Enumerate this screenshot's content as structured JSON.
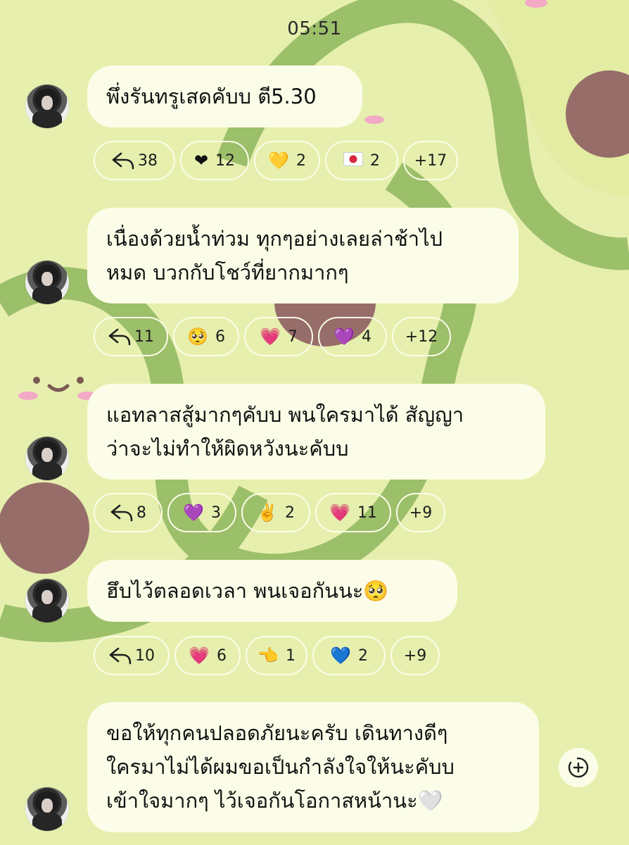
{
  "status": {
    "time": "05:51"
  },
  "messages": [
    {
      "lines": [
        "พึ่งรันทรูเสดคับบ ตี5.30"
      ],
      "reactions": [
        {
          "icon": "reply-arrow",
          "emoji": "",
          "count": "38"
        },
        {
          "icon": "black-heart",
          "emoji": "❤",
          "count": "12"
        },
        {
          "icon": "yellow-heart",
          "emoji": "💛",
          "count": "2"
        },
        {
          "icon": "japan-flag",
          "emoji": "🇯🇵",
          "count": "2"
        },
        {
          "icon": "more",
          "emoji": "",
          "count": "+17"
        }
      ]
    },
    {
      "lines": [
        "เนื่องด้วยน้ำท่วม ทุกๆอย่างเลยล่าช้าไป",
        "หมด บวกกับโชว์ที่ยากมากๆ"
      ],
      "reactions": [
        {
          "icon": "reply-arrow",
          "emoji": "",
          "count": "11"
        },
        {
          "icon": "pleading-face",
          "emoji": "🥺",
          "count": "6"
        },
        {
          "icon": "pink-heart",
          "emoji": "💗",
          "count": "7"
        },
        {
          "icon": "purple-heart",
          "emoji": "💜",
          "count": "4"
        },
        {
          "icon": "more",
          "emoji": "",
          "count": "+12"
        }
      ]
    },
    {
      "lines": [
        "แอทลาสสู้มากๆคับบ พนใครมาได้ สัญญา",
        "ว่าจะไม่ทำให้ผิดหวังนะคับบ"
      ],
      "reactions": [
        {
          "icon": "reply-arrow",
          "emoji": "",
          "count": "8"
        },
        {
          "icon": "purple-heart",
          "emoji": "💜",
          "count": "3"
        },
        {
          "icon": "victory-hand",
          "emoji": "✌️",
          "count": "2"
        },
        {
          "icon": "growing-heart",
          "emoji": "💗",
          "count": "11"
        },
        {
          "icon": "more",
          "emoji": "",
          "count": "+9"
        }
      ]
    },
    {
      "lines": [
        "ฮึบไว้ตลอดเวลา พนเจอกันนะ🥺"
      ],
      "reactions": [
        {
          "icon": "reply-arrow",
          "emoji": "",
          "count": "10"
        },
        {
          "icon": "pink-heart",
          "emoji": "💗",
          "count": "6"
        },
        {
          "icon": "pointing-hand",
          "emoji": "👈",
          "count": "1"
        },
        {
          "icon": "blue-heart",
          "emoji": "💙",
          "count": "2"
        },
        {
          "icon": "more",
          "emoji": "",
          "count": "+9"
        }
      ]
    },
    {
      "lines": [
        "ขอให้ทุกคนปลอดภัยนะครับ เดินทางดีๆ",
        "ใครมาไม่ได้ผมขอเป็นกำลังใจให้นะคับบ",
        "เข้าใจมากๆ ไว้เจอกันโอกาสหน้านะ🤍"
      ],
      "reactions": []
    }
  ],
  "colors": {
    "background": "#e7efae",
    "bubble": "#fbfde8",
    "avocado_skin": "#9cbf6a",
    "pit": "#976d6a"
  }
}
